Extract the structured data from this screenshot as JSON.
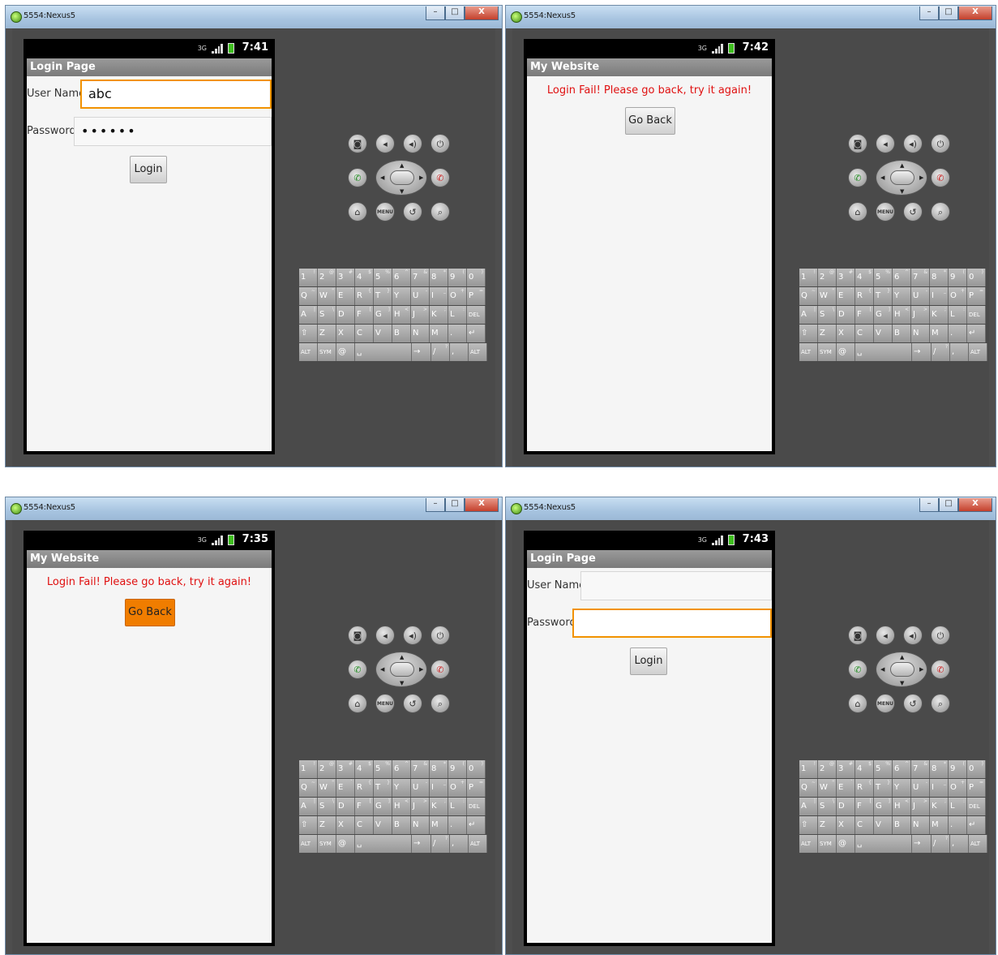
{
  "window_title": "5554:Nexus5",
  "window_buttons": {
    "minimize": "–",
    "maximize": "□",
    "close": "X"
  },
  "panels": [
    {
      "id": "panel1",
      "time": "7:41",
      "app_title": "Login Page",
      "screen_type": "login",
      "username_label": "User Name",
      "username_value": "abc",
      "password_label": "Password",
      "password_value": "••••••",
      "focused_field": "username",
      "login_button": "Login"
    },
    {
      "id": "panel2",
      "time": "7:42",
      "app_title": "My Website",
      "screen_type": "fail",
      "message": "Login Fail! Please go back, try it again!",
      "go_back_button": "Go Back",
      "button_pressed": false
    },
    {
      "id": "panel3",
      "time": "7:35",
      "app_title": "My Website",
      "screen_type": "fail",
      "message": "Login Fail! Please go back, try it again!",
      "go_back_button": "Go Back",
      "button_pressed": true
    },
    {
      "id": "panel4",
      "time": "7:43",
      "app_title": "Login Page",
      "screen_type": "login",
      "username_label": "User Name",
      "username_value": "",
      "password_label": "Password",
      "password_value": "",
      "focused_field": "password",
      "login_button": "Login"
    }
  ],
  "status_icons": {
    "network": "3G",
    "signal": "signal-icon",
    "battery": "battery-icon"
  },
  "colors": {
    "focus_orange": "#f29200",
    "pressed_orange": "#f07d00",
    "error_red": "#e01010",
    "emulator_bg": "#4a4a4a"
  },
  "emulator_controls": {
    "top_row": [
      "camera-icon",
      "volume-down-icon",
      "volume-up-icon",
      "power-icon"
    ],
    "middle_row": [
      "call-icon",
      "dpad",
      "end-call-icon"
    ],
    "bottom_row": [
      "home-icon",
      "MENU",
      "back-icon",
      "search-icon"
    ]
  },
  "keyboard": {
    "rows": [
      [
        [
          "1",
          "!"
        ],
        [
          "2",
          "@"
        ],
        [
          "3",
          "#"
        ],
        [
          "4",
          "$"
        ],
        [
          "5",
          "%"
        ],
        [
          "6",
          "^"
        ],
        [
          "7",
          "&"
        ],
        [
          "8",
          "*"
        ],
        [
          "9",
          "("
        ],
        [
          "0",
          ")"
        ]
      ],
      [
        [
          "Q",
          "~"
        ],
        [
          "W",
          "\""
        ],
        [
          "E",
          "`"
        ],
        [
          "R",
          "{"
        ],
        [
          "T",
          "}"
        ],
        [
          "Y",
          ""
        ],
        [
          "U",
          "-"
        ],
        [
          "I",
          "_"
        ],
        [
          "O",
          "+"
        ],
        [
          "P",
          "="
        ]
      ],
      [
        [
          "A",
          "|"
        ],
        [
          "S",
          "\\"
        ],
        [
          "D",
          ""
        ],
        [
          "F",
          "["
        ],
        [
          "G",
          "]"
        ],
        [
          "H",
          "<"
        ],
        [
          "J",
          ">"
        ],
        [
          "K",
          ";"
        ],
        [
          "L",
          ":"
        ],
        [
          "DEL",
          ""
        ]
      ],
      [
        [
          "⇧",
          ""
        ],
        [
          "Z",
          ""
        ],
        [
          "X",
          ""
        ],
        [
          "C",
          ""
        ],
        [
          "V",
          ""
        ],
        [
          "B",
          ""
        ],
        [
          "N",
          ""
        ],
        [
          "M",
          ""
        ],
        [
          ".",
          ""
        ],
        [
          "↵",
          ""
        ]
      ],
      [
        [
          "ALT",
          ""
        ],
        [
          "SYM",
          ""
        ],
        [
          "@",
          ""
        ],
        [
          "␣",
          ""
        ],
        [
          "→",
          ""
        ],
        [
          "/",
          "?"
        ],
        [
          ",",
          ""
        ],
        [
          "ALT",
          ""
        ]
      ]
    ]
  }
}
